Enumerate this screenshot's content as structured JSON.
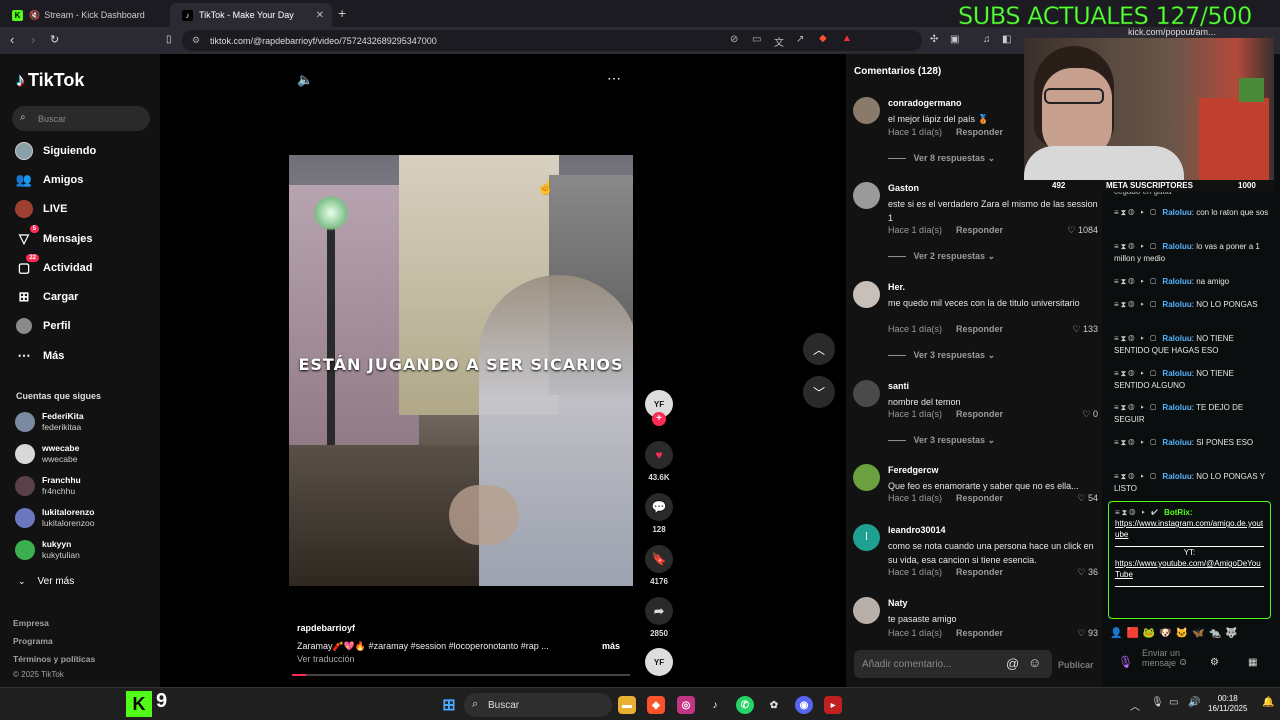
{
  "browser": {
    "tabs": [
      {
        "label": "Stream - Kick Dashboard",
        "active": false
      },
      {
        "label": "TikTok - Make Your Day",
        "active": true
      }
    ],
    "url": "tiktok.com/@rapdebarrioyf/video/7572432689295347000",
    "popout_url": "kick.com/popout/am..."
  },
  "tiktok": {
    "logo": "TikTok",
    "search_placeholder": "Buscar",
    "nav": [
      {
        "label": "Siguiendo",
        "icon": "following-icon",
        "badge": ""
      },
      {
        "label": "Amigos",
        "icon": "friends-icon",
        "badge": ""
      },
      {
        "label": "LIVE",
        "icon": "live-icon",
        "badge": ""
      },
      {
        "label": "Mensajes",
        "icon": "messages-icon",
        "badge": "5"
      },
      {
        "label": "Actividad",
        "icon": "activity-icon",
        "badge": "22"
      },
      {
        "label": "Cargar",
        "icon": "upload-icon",
        "badge": ""
      },
      {
        "label": "Perfil",
        "icon": "profile-icon",
        "badge": ""
      },
      {
        "label": "Más",
        "icon": "more-icon",
        "badge": ""
      }
    ],
    "following_title": "Cuentas que sigues",
    "following": [
      {
        "name": "FederiKita",
        "handle": "federikitaa",
        "color": "#7a8aa0"
      },
      {
        "name": "wwecabe",
        "handle": "wwecabe",
        "color": "#d8d8d8"
      },
      {
        "name": "Franchhu",
        "handle": "fr4nchhu",
        "color": "#5a4048"
      },
      {
        "name": "lukitalorenzo",
        "handle": "lukitalorenzoo",
        "color": "#6a78c0"
      },
      {
        "name": "kukyyn",
        "handle": "kukytulian",
        "color": "#3ab050"
      }
    ],
    "see_more": "Ver más",
    "footer": [
      "Empresa",
      "Programa",
      "Términos y políticas",
      "© 2025 TikTok"
    ],
    "video": {
      "overlay_text": "ESTÁN JUGANDO A SER SICARIOS",
      "author": "rapdebarrioyf",
      "description": "Zaramay🧨💖🔥 #zaramay #session #locoperonotanto  #rap ...",
      "more": "más",
      "translate": "Ver traducción",
      "likes": "43.6K",
      "comments": "128",
      "saves": "4176",
      "shares": "2850"
    },
    "comments_title": "Comentarios (128)",
    "comments": [
      {
        "user": "conradogermano",
        "text": "el mejor lápiz del país 🥉",
        "time": "Hace 1 día(s)",
        "reply": "Responder",
        "likes": "",
        "more": "Ver 8 respuestas",
        "color": "#8a7a6a"
      },
      {
        "user": "Gaston",
        "text": "este si es el verdadero Zara el mismo de las session 1",
        "time": "Hace 1 día(s)",
        "reply": "Responder",
        "likes": "1084",
        "more": "Ver 2 respuestas",
        "color": "#9a9a9a"
      },
      {
        "user": "Her.",
        "text": "me quedo mil veces con la de titulo universitario",
        "time": "Hace 1 día(s)",
        "reply": "Responder",
        "likes": "133",
        "more": "Ver 3 respuestas",
        "color": "#c8c0b8"
      },
      {
        "user": "santi",
        "text": "nombre del temon",
        "time": "Hace 1 día(s)",
        "reply": "Responder",
        "likes": "0",
        "more": "Ver 3 respuestas",
        "color": "#4a4a4a"
      },
      {
        "user": "Feredgercw",
        "text": "Que feo es enamorarte y saber que no es ella...",
        "time": "Hace 1 día(s)",
        "reply": "Responder",
        "likes": "54",
        "more": "",
        "color": "#6aa040"
      },
      {
        "user": "leandro30014",
        "text": "como se nota cuando una persona hace un click en su vida, esa cancion si tiene esencia.",
        "time": "Hace 1 día(s)",
        "reply": "Responder",
        "likes": "36",
        "more": "",
        "color": "#20a090"
      },
      {
        "user": "Naty",
        "text": "te pasaste amigo",
        "time": "Hace 1 día(s)",
        "reply": "Responder",
        "likes": "93",
        "more": "",
        "color": "#b8b0a8"
      }
    ],
    "add_comment_placeholder": "Añadir comentario...",
    "publish": "Publicar"
  },
  "kick": {
    "overlay_title": "SUBS ACTUALES 127/500",
    "meta_left": "492",
    "meta_label": "META SUSCRIPTORES",
    "meta_right": "1000",
    "top_fragment": "cegado en gutta",
    "messages": [
      {
        "user": "Raloluu",
        "text": "con lo raton que sos"
      },
      {
        "user": "Raloluu",
        "text": "lo vas a poner a 1 millon y medio"
      },
      {
        "user": "Raloluu",
        "text": "na amigo"
      },
      {
        "user": "Raloluu",
        "text": "NO LO PONGAS"
      },
      {
        "user": "Raloluu",
        "text": "NO TIENE SENTIDO QUE HAGAS ESO"
      },
      {
        "user": "Raloluu",
        "text": "NO TIENE SENTIDO ALGUNO"
      },
      {
        "user": "Raloluu",
        "text": "TE DEJO DE SEGUIR"
      },
      {
        "user": "Raloluu",
        "text": "SI PONES ESO"
      },
      {
        "user": "Raloluu",
        "text": "NO LO PONGAS Y LISTO"
      }
    ],
    "bot": {
      "user": "BotRix:",
      "link1": "https://www.instagram.com/amigo.de.youtube",
      "yt_label": "YT:",
      "link2": "https://www.youtube.com/@AmigoDeYouTube"
    },
    "send_placeholder": "Enviar un mensaje"
  },
  "taskbar": {
    "kick_count": "9",
    "search": "Buscar",
    "time": "00:18",
    "date": "16/11/2025"
  }
}
